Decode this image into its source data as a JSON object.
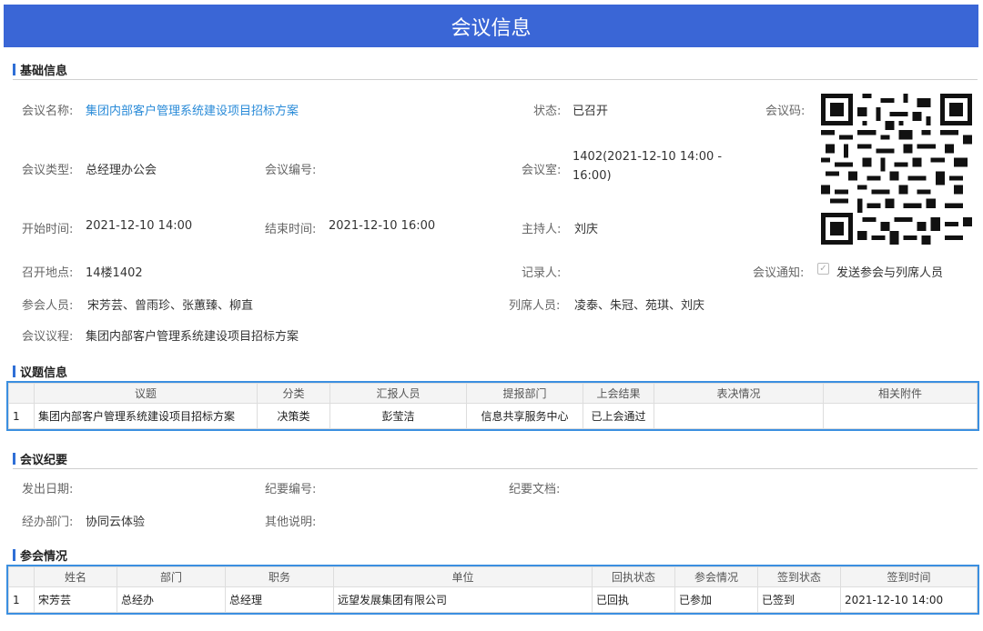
{
  "page_title": "会议信息",
  "sections": {
    "basic": "基础信息",
    "topics": "议题信息",
    "minutes": "会议纪要",
    "attendance": "参会情况"
  },
  "basic": {
    "name_label": "会议名称:",
    "name_value": "集团内部客户管理系统建设项目招标方案",
    "status_label": "状态:",
    "status_value": "已召开",
    "code_label": "会议码:",
    "type_label": "会议类型:",
    "type_value": "总经理办公会",
    "number_label": "会议编号:",
    "number_value": "",
    "room_label": "会议室:",
    "room_value_line1": "1402(2021-12-10 14:00 -",
    "room_value_line2": "16:00)",
    "start_label": "开始时间:",
    "start_value": "2021-12-10 14:00",
    "end_label": "结束时间:",
    "end_value": "2021-12-10 16:00",
    "host_label": "主持人:",
    "host_value": "刘庆",
    "place_label": "召开地点:",
    "place_value": "14楼1402",
    "recorder_label": "记录人:",
    "recorder_value": "",
    "notice_label": "会议通知:",
    "notice_value": "发送参会与列席人员",
    "participants_label": "参会人员:",
    "participants_value": "宋芳芸、曾雨珍、张蕙臻、柳直",
    "attendees_label": "列席人员:",
    "attendees_value": "凌泰、朱冠、苑琪、刘庆",
    "agenda_label": "会议议程:",
    "agenda_value": "集团内部客户管理系统建设项目招标方案"
  },
  "topics_table": {
    "headers": [
      "",
      "议题",
      "分类",
      "汇报人员",
      "提报部门",
      "上会结果",
      "表决情况",
      "相关附件"
    ],
    "rows": [
      [
        "1",
        "集团内部客户管理系统建设项目招标方案",
        "决策类",
        "彭莹洁",
        "信息共享服务中心",
        "已上会通过",
        "",
        ""
      ]
    ]
  },
  "minutes": {
    "date_label": "发出日期:",
    "date_value": "",
    "number_label": "纪要编号:",
    "number_value": "",
    "doc_label": "纪要文档:",
    "doc_value": "",
    "dept_label": "经办部门:",
    "dept_value": "协同云体验",
    "other_label": "其他说明:",
    "other_value": ""
  },
  "attendance_table": {
    "headers": [
      "",
      "姓名",
      "部门",
      "职务",
      "单位",
      "回执状态",
      "参会情况",
      "签到状态",
      "签到时间"
    ],
    "rows": [
      [
        "1",
        "宋芳芸",
        "总经办",
        "总经理",
        "远望发展集团有限公司",
        "已回执",
        "已参加",
        "已签到",
        "2021-12-10 14:00"
      ]
    ]
  },
  "colors": {
    "title_bg": "#3a66d6",
    "accent": "#2f6fd6",
    "link": "#2a8bd8",
    "table_border": "#3b8fe0"
  },
  "icons": [
    "qr-code-icon",
    "checkbox-checked-icon"
  ]
}
